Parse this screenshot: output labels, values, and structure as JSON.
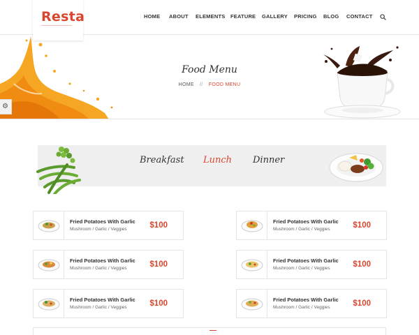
{
  "header": {
    "logo": "Resta",
    "nav": [
      "HOME",
      "ABOUT",
      "ELEMENTS",
      "FEATURE",
      "GALLERY",
      "PRICING",
      "BLOG",
      "CONTACT"
    ],
    "search_icon": "search-icon"
  },
  "banner": {
    "title": "Food Menu",
    "breadcrumb": {
      "home": "HOME",
      "separator": "//",
      "current": "FOOD MENU"
    },
    "settings_icon": "gear-icon"
  },
  "tabs": {
    "items": [
      "Breakfast",
      "Lunch",
      "Dinner"
    ],
    "active": "Lunch"
  },
  "menu": {
    "items": [
      {
        "title": "Fried Potatoes With Garlic",
        "desc": "Mushroom / Garlic / Veggies",
        "price": "$100"
      },
      {
        "title": "Fried Potatoes With Garlic",
        "desc": "Mushroom / Garlic / Veggies",
        "price": "$100"
      },
      {
        "title": "Fried Potatoes With Garlic",
        "desc": "Mushroom / Garlic / Veggies",
        "price": "$100"
      },
      {
        "title": "Fried Potatoes With Garlic",
        "desc": "Mushroom / Garlic / Veggies",
        "price": "$100"
      },
      {
        "title": "Fried Potatoes With Garlic",
        "desc": "Mushroom / Garlic / Veggies",
        "price": "$100"
      },
      {
        "title": "Fried Potatoes With Garlic",
        "desc": "Mushroom / Garlic / Veggies",
        "price": "$100"
      }
    ]
  },
  "colors": {
    "accent": "#d9462e",
    "text": "#333333",
    "band": "#efefef"
  }
}
